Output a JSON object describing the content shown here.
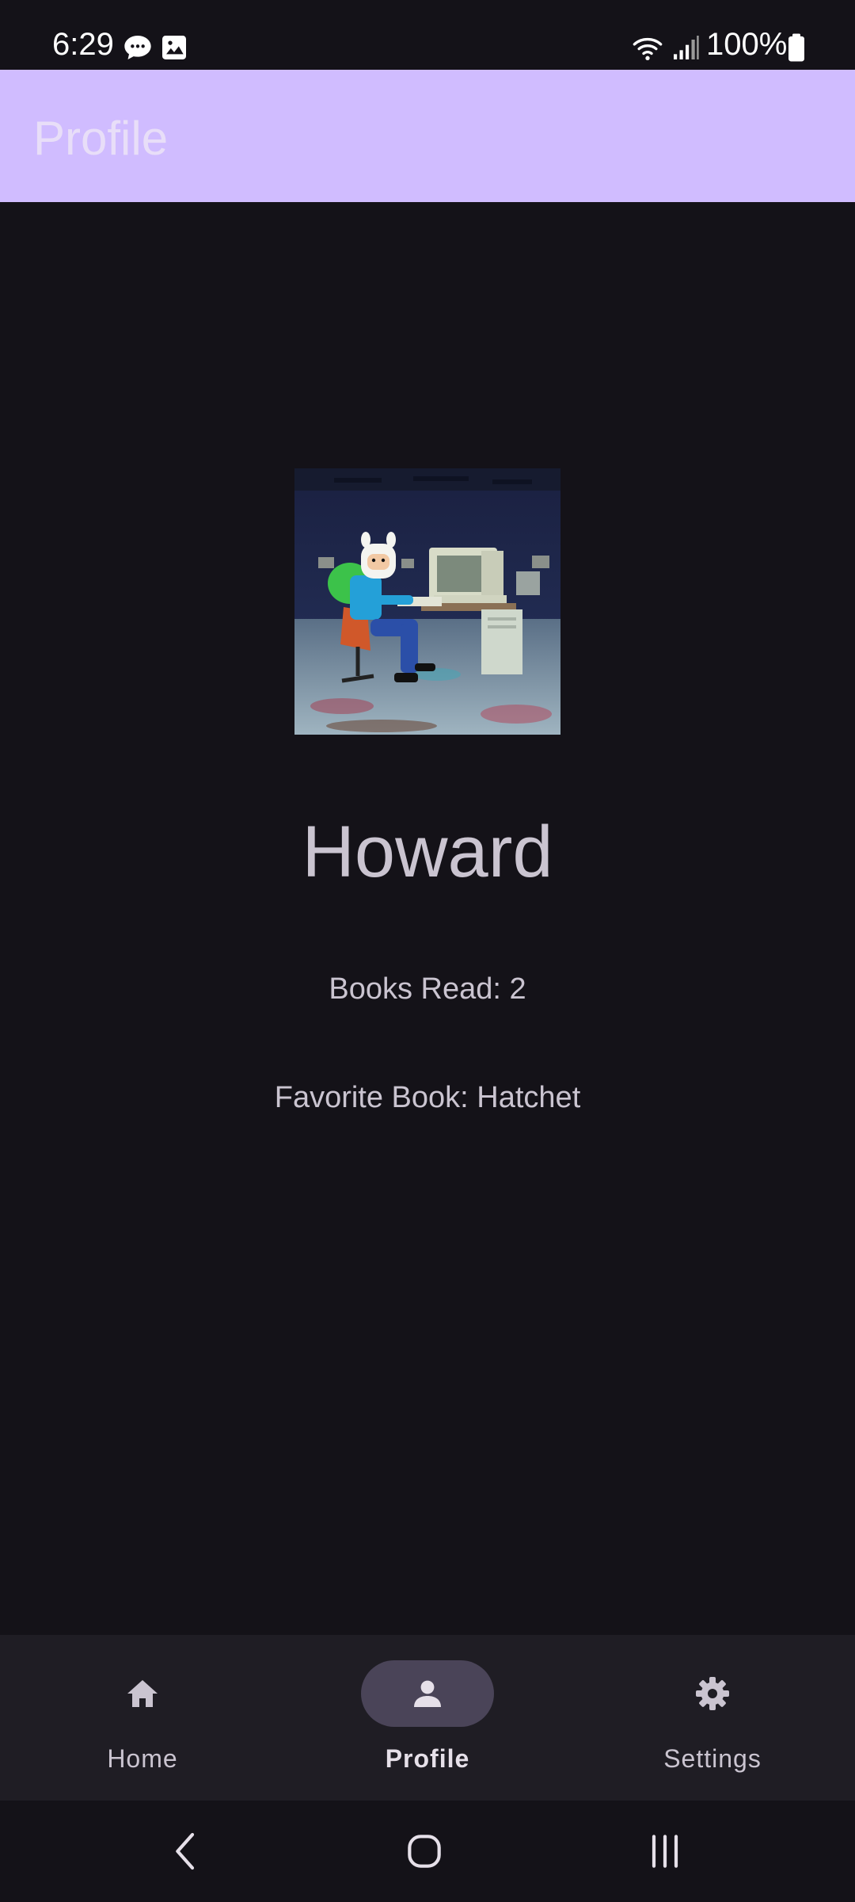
{
  "status_bar": {
    "time": "6:29",
    "battery_text": "100%",
    "icons": [
      "chat-bubble-icon",
      "image-icon",
      "wifi-icon",
      "signal-icon",
      "battery-icon"
    ]
  },
  "app_bar": {
    "title": "Profile"
  },
  "profile": {
    "name": "Howard",
    "books_read": "Books Read: 2",
    "favorite_book": "Favorite Book: Hatchet"
  },
  "bottom_nav": {
    "items": [
      {
        "label": "Home",
        "icon": "home-icon",
        "active": false
      },
      {
        "label": "Profile",
        "icon": "person-icon",
        "active": true
      },
      {
        "label": "Settings",
        "icon": "gear-icon",
        "active": false
      }
    ]
  },
  "system_nav": {
    "buttons": [
      "back-icon",
      "home-circle-icon",
      "recents-icon"
    ]
  },
  "colors": {
    "background": "#141218",
    "app_bar": "#D0BCFF",
    "app_bar_title": "#E8DEF8",
    "nav_bar": "#1F1D24",
    "nav_active_indicator": "#4A4458",
    "text_secondary": "#CAC4D0"
  }
}
